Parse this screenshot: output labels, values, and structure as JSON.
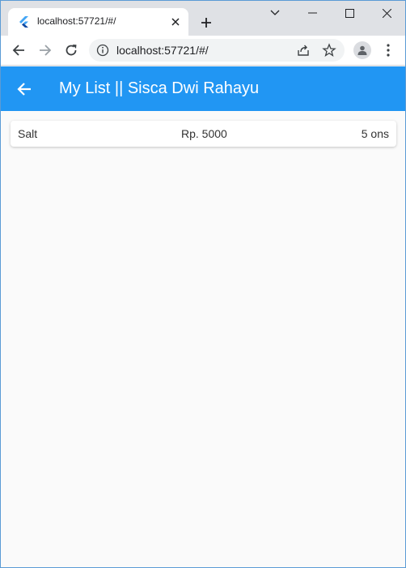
{
  "browser": {
    "tab": {
      "title": "localhost:57721/#/",
      "favicon": "flutter-icon"
    },
    "toolbar": {
      "url": "localhost:57721/#/"
    },
    "icons": {
      "back": "arrow-left-icon",
      "forward": "arrow-right-icon",
      "reload": "reload-icon",
      "info": "info-icon",
      "share": "share-icon",
      "bookmark": "star-icon",
      "profile": "person-icon",
      "menu": "kebab-menu-icon"
    }
  },
  "app": {
    "appbar": {
      "title": "My List || Sisca Dwi Rahayu",
      "back_icon": "arrow-back-icon"
    },
    "items": [
      {
        "name": "Salt",
        "price": "Rp. 5000",
        "quantity": "5 ons"
      }
    ]
  },
  "colors": {
    "appbar": "#2196f3",
    "background": "#fafafa",
    "tabstrip": "#dfe1e5"
  }
}
